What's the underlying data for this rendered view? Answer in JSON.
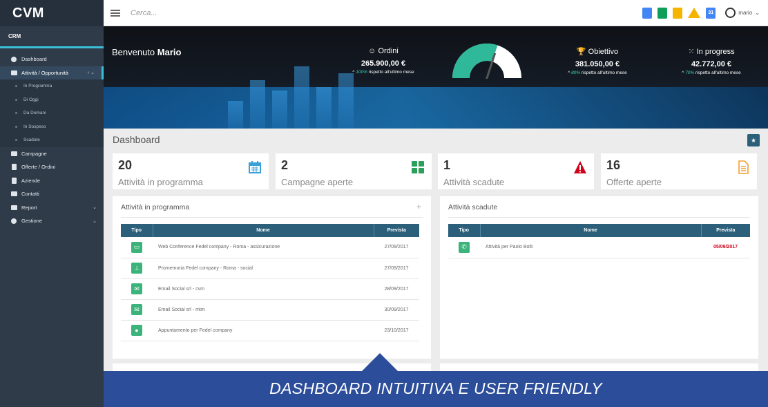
{
  "brand": {
    "logo": "CVM",
    "section": "CRM"
  },
  "sidebar": {
    "items": [
      {
        "label": "Dashboard"
      },
      {
        "label": "Attività / Opportunità"
      },
      {
        "label": "Campagne"
      },
      {
        "label": "Offerte / Ordini"
      },
      {
        "label": "Aziende"
      },
      {
        "label": "Contatti"
      },
      {
        "label": "Report"
      },
      {
        "label": "Gestione"
      }
    ],
    "subitems": [
      {
        "label": "In Programma"
      },
      {
        "label": "Di Oggi"
      },
      {
        "label": "Da Domani"
      },
      {
        "label": "In Sospeso"
      },
      {
        "label": "Scadute"
      }
    ]
  },
  "topbar": {
    "search_placeholder": "Cerca...",
    "calendar_day": "31",
    "user_name": "mario"
  },
  "hero": {
    "welcome_prefix": "Benvenuto",
    "welcome_name": "Mario",
    "stats": [
      {
        "label": "Ordini",
        "value": "265.900,00 €",
        "pct": "100%",
        "sub": "rispetto all'ultimo mese"
      },
      {
        "label": "Obiettivo",
        "value": "381.050,00 €",
        "pct": "80%",
        "sub": "rispetto all'ultimo mese"
      },
      {
        "label": "In progress",
        "value": "42.772,00 €",
        "pct": "70%",
        "sub": "rispetto all'ultimo mese"
      }
    ],
    "gauge_fraction": 0.6
  },
  "dashboard": {
    "title": "Dashboard",
    "kpis": [
      {
        "value": "20",
        "label": "Attività in programma",
        "icon": "calendar-icon",
        "color": "#3aa0d8"
      },
      {
        "value": "2",
        "label": "Campagne aperte",
        "icon": "grid-icon",
        "color": "#2aa05a"
      },
      {
        "value": "1",
        "label": "Attività scadute",
        "icon": "warning-icon",
        "color": "#d0021b"
      },
      {
        "value": "16",
        "label": "Offerte aperte",
        "icon": "document-icon",
        "color": "#f0a030"
      }
    ]
  },
  "panel_programma": {
    "title": "Attività in programma",
    "headers": [
      "Tipo",
      "Nome",
      "Prevista"
    ],
    "rows": [
      {
        "icon": "laptop-icon",
        "name": "Web Conference Fedel company - Roma - assicurazione",
        "date": "27/09/2017"
      },
      {
        "icon": "pin-icon",
        "name": "Promemoria Fedel company - Roma - social",
        "date": "27/09/2017"
      },
      {
        "icon": "mail-icon",
        "name": "Email Social srl - cvm",
        "date": "28/09/2017"
      },
      {
        "icon": "mail-icon",
        "name": "Email Social srl - mtm",
        "date": "30/09/2017"
      },
      {
        "icon": "location-icon",
        "name": "Appuntamento per Fedel company",
        "date": "23/10/2017"
      }
    ]
  },
  "panel_scadute": {
    "title": "Attività scadute",
    "headers": [
      "Tipo",
      "Nome",
      "Prevista"
    ],
    "rows": [
      {
        "icon": "phone-icon",
        "name": "Attività per Paolo Bolti",
        "date": "05/09/2017"
      }
    ]
  },
  "banner": {
    "text": "DASHBOARD INTUITIVA E USER FRIENDLY"
  },
  "colors": {
    "sidebar": "#2f3b49",
    "accent": "#3bbfd9",
    "table_header": "#2b5f7a",
    "banner": "#2c4e9a",
    "overdue": "#d0021b"
  }
}
